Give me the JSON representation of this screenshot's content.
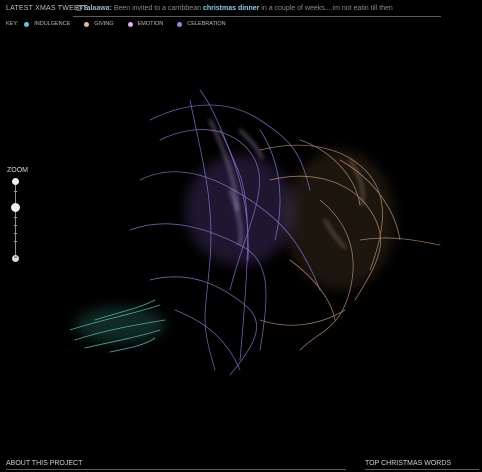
{
  "header": {
    "latest_label": "LATEST XMAS TWEETS:",
    "tweet_user": "@Talaawa:",
    "tweet_text_before": " Been invited to a carribbean ",
    "tweet_keyword": "christmas dinner",
    "tweet_text_after": " in a couple of weeks....im not eatin till then"
  },
  "key": {
    "title": "KEY:",
    "items": [
      {
        "label": "INDULGENCE",
        "color": "#5bc6e6"
      },
      {
        "label": "GIVING",
        "color": "#e8b98a"
      },
      {
        "label": "EMOTION",
        "color": "#dcb3e6"
      },
      {
        "label": "CELEBRATION",
        "color": "#a27fe6"
      }
    ]
  },
  "zoom": {
    "label": "ZOOM",
    "minus_glyph": "−"
  },
  "footer": {
    "about": "ABOUT THIS PROJECT",
    "top_words": "TOP CHRISTMAS WORDS"
  }
}
